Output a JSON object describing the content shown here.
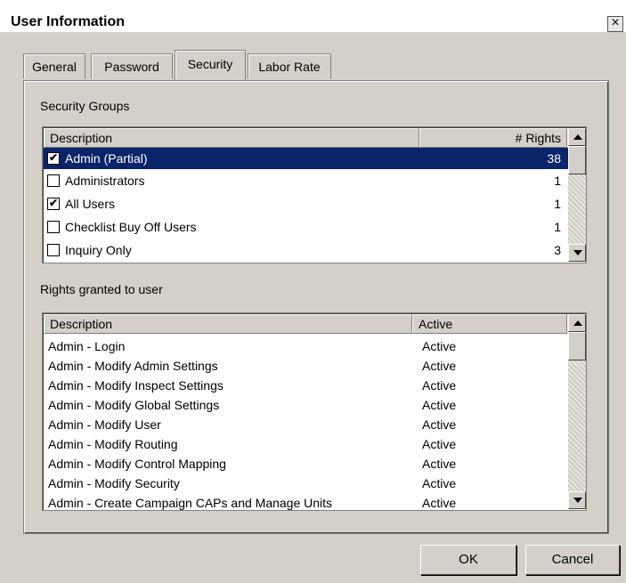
{
  "window": {
    "title": "User Information",
    "close_glyph": "×"
  },
  "tabs": [
    {
      "label": "General"
    },
    {
      "label": "Password"
    },
    {
      "label": "Security"
    },
    {
      "label": "Labor Rate"
    }
  ],
  "active_tab": "Security",
  "security_groups": {
    "label": "Security Groups",
    "columns": [
      "Description",
      "# Rights"
    ],
    "rows": [
      {
        "checked": true,
        "check_glyph": "✔",
        "description": "Admin (Partial)",
        "rights": "38",
        "selected": true
      },
      {
        "checked": false,
        "check_glyph": "",
        "description": "Administrators",
        "rights": "1"
      },
      {
        "checked": true,
        "check_glyph": "✔",
        "description": "All Users",
        "rights": "1"
      },
      {
        "checked": false,
        "check_glyph": "",
        "description": "Checklist Buy Off Users",
        "rights": "1"
      },
      {
        "checked": false,
        "check_glyph": "",
        "description": "Inquiry Only",
        "rights": "3"
      }
    ]
  },
  "rights": {
    "label": "Rights granted to user",
    "columns": [
      "Description",
      "Active"
    ],
    "rows": [
      {
        "description": "Admin - Login",
        "active": "Active"
      },
      {
        "description": "Admin - Modify Admin Settings",
        "active": "Active"
      },
      {
        "description": "Admin - Modify Inspect Settings",
        "active": "Active"
      },
      {
        "description": "Admin - Modify Global Settings",
        "active": "Active"
      },
      {
        "description": "Admin - Modify User",
        "active": "Active"
      },
      {
        "description": "Admin - Modify Routing",
        "active": "Active"
      },
      {
        "description": "Admin - Modify Control Mapping",
        "active": "Active"
      },
      {
        "description": "Admin - Modify Security",
        "active": "Active"
      },
      {
        "description": "Admin - Create Campaign CAPs and Manage Units",
        "active": "Active"
      }
    ]
  },
  "buttons": {
    "ok": "OK",
    "cancel": "Cancel"
  },
  "colors": {
    "selection": "#0a246a",
    "dialog_bg": "#d4d0c8"
  }
}
